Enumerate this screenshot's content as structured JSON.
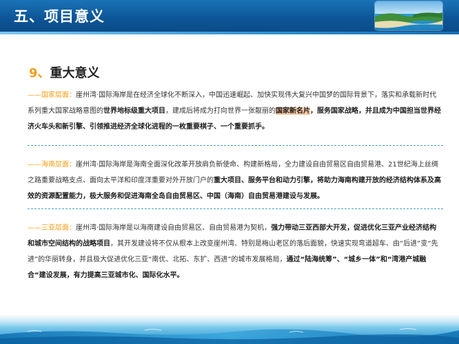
{
  "header": {
    "title": "五、项目意义"
  },
  "section": {
    "number": "9",
    "separator": "、",
    "title": "重大意义"
  },
  "paragraphs": [
    {
      "dash": "——",
      "label": "国家层面：",
      "runs": [
        {
          "text": "崖州湾·国际海岸是在经济全球化不断深入，中国迅速崛起、加快实现伟大复兴中国梦的国际背景下，落实和承载新时代系列重大国家战略意图的",
          "style": "normal"
        },
        {
          "text": "世界地标级重大项目",
          "style": "bold"
        },
        {
          "text": "，建成后将成为打向世界一张靓丽的",
          "style": "normal"
        },
        {
          "text": "国家新名片",
          "style": "highlight"
        },
        {
          "text": "，服务国家战略，并且成为中国担当世界经济火车头和新引擎、引领推进经济全球化进程的一枚重要棋子、一个重要抓手。",
          "style": "bold"
        }
      ]
    },
    {
      "dash": "——",
      "label": "海南层面：",
      "runs": [
        {
          "text": "崖州湾·国际海岸是海南全面深化改革开放肩负新使命、构建新格局，全力建设自由贸易区自由贸易港、21世纪海上丝绸之路重要战略支点、面向太平洋和印度洋重要对外开放门户的",
          "style": "normal"
        },
        {
          "text": "重大项目、服务平台和动力引擎，将助力海南构建开放的经济结构体系及高效的资源配置能力，极大服务和促进海南全岛自由贸易区、中国（海南）自由贸易港建设与发展。",
          "style": "bold"
        }
      ]
    },
    {
      "dash": "——",
      "label": "三亚层面：",
      "runs": [
        {
          "text": "崖州湾·国际海岸是以海南建设自由贸易区、自由贸易港为契机，",
          "style": "normal"
        },
        {
          "text": "强力带动三亚西部大开发，促进优化三亚产业经济结构和城市空间结构的战略项目",
          "style": "bold"
        },
        {
          "text": "，其开发建设将不仅从根本上改变崖州湾、特别是梅山老区的落后面貌，快速实现弯道超车、由“后进”变“先进”的华丽转身，并且极大促进优化三亚“南优、北拓、东扩、西进”的城市发展格局，",
          "style": "normal"
        },
        {
          "text": "通过“陆海统筹”、“城乡一体”和“湾港产城融合”建设发展，有力提高三亚城市化、国际化水平。",
          "style": "bold"
        }
      ]
    }
  ],
  "colors": {
    "header_blue": "#0d5596",
    "accent_orange": "#f39c12",
    "highlight_peach": "#f9c9a3",
    "divider_cyan": "#3aa3c8"
  }
}
